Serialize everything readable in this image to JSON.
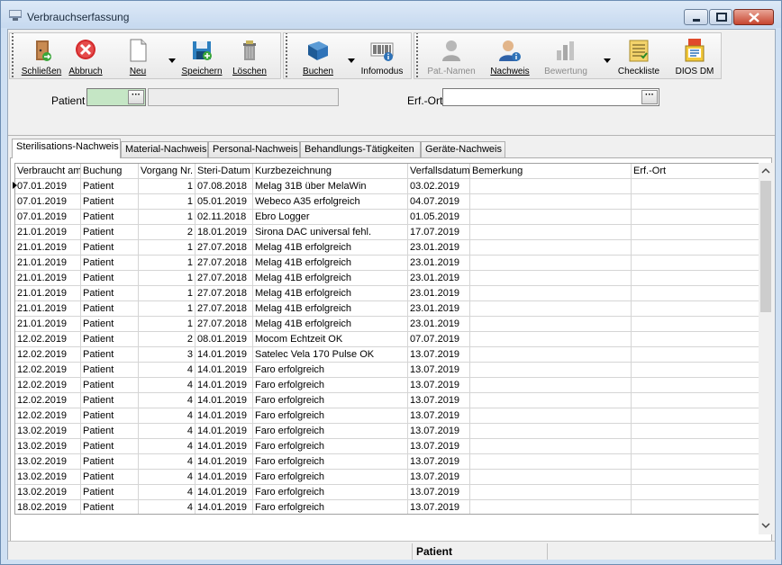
{
  "window": {
    "title": "Verbrauchserfassung"
  },
  "toolbar": {
    "close": "Schließen",
    "cancel": "Abbruch",
    "new": "Neu",
    "save": "Speichern",
    "delete": "Löschen",
    "book": "Buchen",
    "info": "Infomodus",
    "patient_names": "Pat.-Namen",
    "proof": "Nachweis",
    "rating": "Bewertung",
    "checklist": "Checkliste",
    "dios": "DIOS DM"
  },
  "form": {
    "patient_label": "Patient",
    "patient_value": "",
    "location_label": "Erf.-Ort",
    "location_value": "",
    "ellipsis": "···"
  },
  "tabs": [
    "Sterilisations-Nachweis",
    "Material-Nachweis",
    "Personal-Nachweis",
    "Behandlungs-Tätigkeiten",
    "Geräte-Nachweis"
  ],
  "table": {
    "columns": [
      "Verbraucht am",
      "Buchung",
      "Vorgang Nr.",
      "Steri-Datum",
      "Kurzbezeichnung",
      "Verfallsdatum",
      "Bemerkung",
      "Erf.-Ort"
    ],
    "rows": [
      [
        "07.01.2019",
        "Patient",
        "1",
        "07.08.2018",
        "Melag 31B über MelaWin",
        "03.02.2019",
        "",
        ""
      ],
      [
        "07.01.2019",
        "Patient",
        "1",
        "05.01.2019",
        "Webeco A35 erfolgreich",
        "04.07.2019",
        "",
        ""
      ],
      [
        "07.01.2019",
        "Patient",
        "1",
        "02.11.2018",
        "Ebro Logger",
        "01.05.2019",
        "",
        ""
      ],
      [
        "21.01.2019",
        "Patient",
        "2",
        "18.01.2019",
        "Sirona DAC universal fehl.",
        "17.07.2019",
        "",
        ""
      ],
      [
        "21.01.2019",
        "Patient",
        "1",
        "27.07.2018",
        "Melag 41B erfolgreich",
        "23.01.2019",
        "",
        ""
      ],
      [
        "21.01.2019",
        "Patient",
        "1",
        "27.07.2018",
        "Melag 41B erfolgreich",
        "23.01.2019",
        "",
        ""
      ],
      [
        "21.01.2019",
        "Patient",
        "1",
        "27.07.2018",
        "Melag 41B erfolgreich",
        "23.01.2019",
        "",
        ""
      ],
      [
        "21.01.2019",
        "Patient",
        "1",
        "27.07.2018",
        "Melag 41B erfolgreich",
        "23.01.2019",
        "",
        ""
      ],
      [
        "21.01.2019",
        "Patient",
        "1",
        "27.07.2018",
        "Melag 41B erfolgreich",
        "23.01.2019",
        "",
        ""
      ],
      [
        "21.01.2019",
        "Patient",
        "1",
        "27.07.2018",
        "Melag 41B erfolgreich",
        "23.01.2019",
        "",
        ""
      ],
      [
        "12.02.2019",
        "Patient",
        "2",
        "08.01.2019",
        "Mocom Echtzeit OK",
        "07.07.2019",
        "",
        ""
      ],
      [
        "12.02.2019",
        "Patient",
        "3",
        "14.01.2019",
        "Satelec Vela 170 Pulse OK",
        "13.07.2019",
        "",
        ""
      ],
      [
        "12.02.2019",
        "Patient",
        "4",
        "14.01.2019",
        "Faro erfolgreich",
        "13.07.2019",
        "",
        ""
      ],
      [
        "12.02.2019",
        "Patient",
        "4",
        "14.01.2019",
        "Faro erfolgreich",
        "13.07.2019",
        "",
        ""
      ],
      [
        "12.02.2019",
        "Patient",
        "4",
        "14.01.2019",
        "Faro erfolgreich",
        "13.07.2019",
        "",
        ""
      ],
      [
        "12.02.2019",
        "Patient",
        "4",
        "14.01.2019",
        "Faro erfolgreich",
        "13.07.2019",
        "",
        ""
      ],
      [
        "13.02.2019",
        "Patient",
        "4",
        "14.01.2019",
        "Faro erfolgreich",
        "13.07.2019",
        "",
        ""
      ],
      [
        "13.02.2019",
        "Patient",
        "4",
        "14.01.2019",
        "Faro erfolgreich",
        "13.07.2019",
        "",
        ""
      ],
      [
        "13.02.2019",
        "Patient",
        "4",
        "14.01.2019",
        "Faro erfolgreich",
        "13.07.2019",
        "",
        ""
      ],
      [
        "13.02.2019",
        "Patient",
        "4",
        "14.01.2019",
        "Faro erfolgreich",
        "13.07.2019",
        "",
        ""
      ],
      [
        "13.02.2019",
        "Patient",
        "4",
        "14.01.2019",
        "Faro erfolgreich",
        "13.07.2019",
        "",
        ""
      ],
      [
        "18.02.2019",
        "Patient",
        "4",
        "14.01.2019",
        "Faro erfolgreich",
        "13.07.2019",
        "",
        ""
      ]
    ]
  },
  "status": {
    "mode": "Patient"
  },
  "colors": {
    "selected_field": "#c5e6c5",
    "title_bar": "#cfe0f3"
  }
}
